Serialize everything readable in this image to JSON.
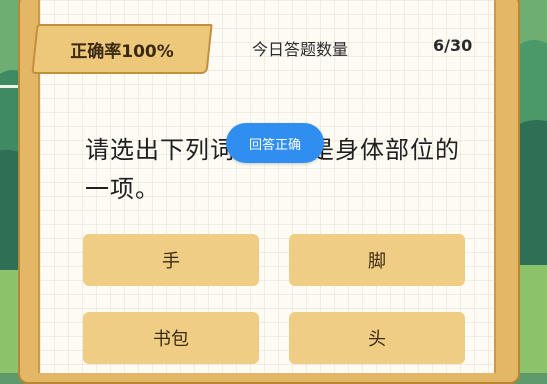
{
  "header": {
    "accuracy": "正确率100%",
    "today_label": "今日答题数量",
    "progress": "6/30"
  },
  "question": {
    "text": "请选出下列词语中不是身体部位的一项。"
  },
  "toast": {
    "text": "回答正确"
  },
  "options": [
    {
      "label": "手"
    },
    {
      "label": "脚"
    },
    {
      "label": "书包"
    },
    {
      "label": "头"
    }
  ],
  "colors": {
    "frame": "#e3b765",
    "option": "#efcd84",
    "toast": "#2f8ef0",
    "paper": "#fdfbf4"
  }
}
